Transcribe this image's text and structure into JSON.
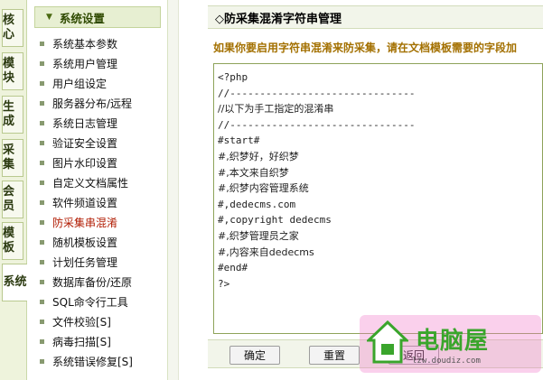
{
  "vtabs": [
    {
      "label": "核心"
    },
    {
      "label": "模块"
    },
    {
      "label": "生成"
    },
    {
      "label": "采集"
    },
    {
      "label": "会员"
    },
    {
      "label": "模板"
    },
    {
      "label": "系统"
    }
  ],
  "sidebar": {
    "header": "系统设置",
    "items": [
      {
        "label": "系统基本参数"
      },
      {
        "label": "系统用户管理"
      },
      {
        "label": "用户组设定"
      },
      {
        "label": "服务器分布/远程"
      },
      {
        "label": "系统日志管理"
      },
      {
        "label": "验证安全设置"
      },
      {
        "label": "图片水印设置"
      },
      {
        "label": "自定义文档属性"
      },
      {
        "label": "软件频道设置"
      },
      {
        "label": "防采集串混淆"
      },
      {
        "label": "随机模板设置"
      },
      {
        "label": "计划任务管理"
      },
      {
        "label": "数据库备份/还原"
      },
      {
        "label": "SQL命令行工具"
      },
      {
        "label": "文件校验[S]"
      },
      {
        "label": "病毒扫描[S]"
      },
      {
        "label": "系统错误修复[S]"
      }
    ]
  },
  "main": {
    "title": "◇防采集混淆字符串管理",
    "notice": "如果你要启用字符串混淆来防采集，请在文档模板需要的字段加",
    "code_lines": [
      "<?php",
      "//-------------------------------",
      "//以下为手工指定的混淆串",
      "//-------------------------------",
      "#start#",
      "#,织梦好，好织梦",
      "#,本文来自织梦",
      "#,织梦内容管理系统",
      "#,dedecms.com",
      "#,copyright dedecms",
      "#,织梦管理员之家",
      "#,内容来自dedecms",
      "#end#",
      "?>"
    ],
    "buttons": {
      "confirm": "确定",
      "reset": "重置",
      "back": "返回"
    }
  },
  "watermark": {
    "text": "电脑屋",
    "url": "lzw.doudiz.com"
  }
}
